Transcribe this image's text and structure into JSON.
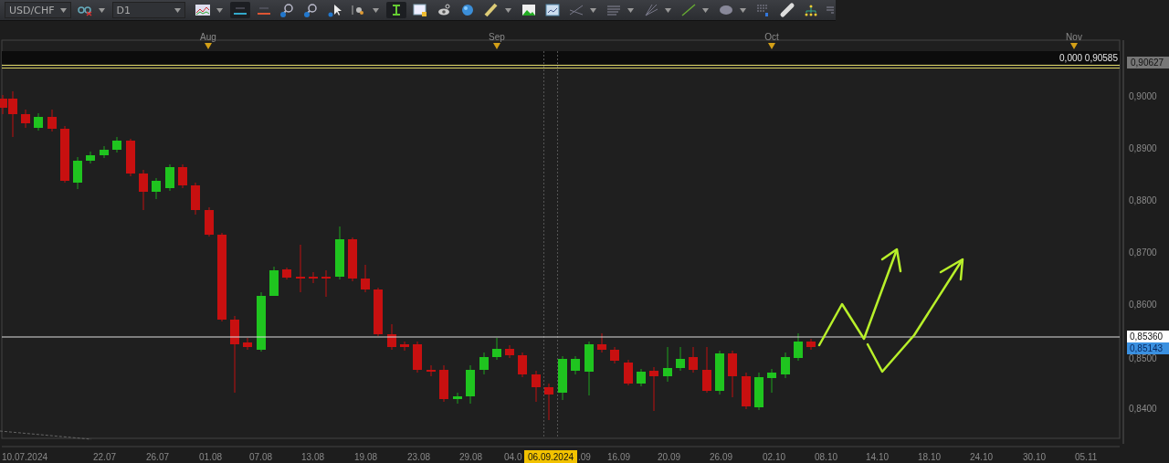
{
  "toolbar": {
    "symbol": "USD/CHF",
    "timeframe": "D1"
  },
  "chart": {
    "months": [
      "Aug",
      "Sep",
      "Oct",
      "Nov"
    ],
    "info_text": "0,000 0,90585",
    "top_badge": "0,90627",
    "price_labels": [
      "0,9000",
      "0,8900",
      "0,8800",
      "0,8700",
      "0,8600",
      "0,8500",
      "0,8400"
    ],
    "bid_badge": "0,85360",
    "ask_badge": "0,85143",
    "date_labels": [
      "10.07.2024",
      "22.07",
      "26.07",
      "01.08",
      "07.08",
      "13.08",
      "19.08",
      "23.08",
      "29.08",
      "04.0",
      ".09",
      "16.09",
      "20.09",
      "26.09",
      "02.10",
      "08.10",
      "14.10",
      "18.10",
      "24.10",
      "30.10",
      "05.11"
    ],
    "cursor_date": "06.09.2024"
  }
}
